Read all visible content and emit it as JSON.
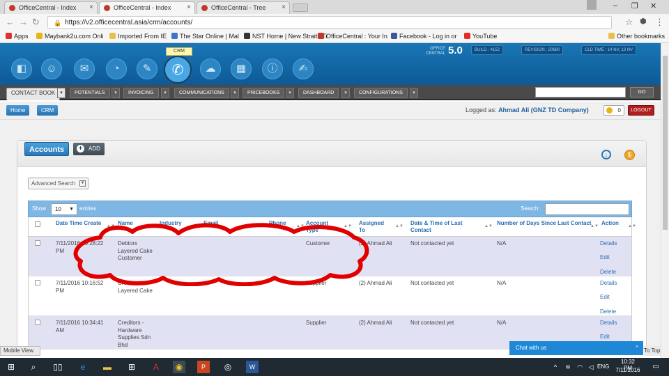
{
  "browser": {
    "tabs": [
      {
        "label": "OfficeCentral - Index"
      },
      {
        "label": "OfficeCentral - Index"
      },
      {
        "label": "OfficeCentral - Tree"
      }
    ],
    "url": "https://v2.officecentral.asia/crm/accounts/",
    "bookmarks": [
      {
        "label": "Apps",
        "color": "#d33"
      },
      {
        "label": "Maybank2u.com Onli",
        "color": "#e7b41a"
      },
      {
        "label": "Imported From IE",
        "color": "#e7c14a"
      },
      {
        "label": "The Star Online | Mal",
        "color": "#3a76c9"
      },
      {
        "label": "NST Home | New Straits Ti",
        "color": "#333"
      },
      {
        "label": "OfficeCentral : Your In",
        "color": "#c0392b"
      },
      {
        "label": "Facebook - Log in or",
        "color": "#3b5998"
      },
      {
        "label": "YouTube",
        "color": "#e52d27"
      },
      {
        "label": "Other bookmarks",
        "color": "#e7c14a"
      }
    ]
  },
  "app": {
    "crm_tooltip": "CRM",
    "brand_small": "OFFICE CENTRAL",
    "brand_version": "5.0",
    "info_boxes": [
      "BUILD : 4152",
      "REVISION : 20680",
      "CLD TIME : 14 NV, 13 NV"
    ],
    "menu": [
      {
        "label": "CONTACT BOOK"
      },
      {
        "label": "POTENTIALS"
      },
      {
        "label": "INVOICING"
      },
      {
        "label": "COMMUNICATIONS"
      },
      {
        "label": "PRICEBOOKS"
      },
      {
        "label": "DASHBOARD"
      },
      {
        "label": "CONFIGURATIONS"
      }
    ],
    "go_label": "GO",
    "breadcrumb": {
      "home": "Home",
      "current": "CRM"
    },
    "logged_label": "Logged as:",
    "logged_user": "Ahmad Ali (GNZ TD Company)",
    "notif_count": "0",
    "logout_label": "LOGOUT"
  },
  "panel": {
    "title": "Accounts",
    "add_label": "ADD",
    "advanced_search": "Advanced Search",
    "show_label": "Show",
    "show_value": "10",
    "entries_label": "entries",
    "search_label": "Search:",
    "columns": [
      {
        "label": "Date Time Create"
      },
      {
        "label": "Name"
      },
      {
        "label": "Industry"
      },
      {
        "label": "Email"
      },
      {
        "label": "Phone"
      },
      {
        "label": "Account Type"
      },
      {
        "label": "Assigned To"
      },
      {
        "label": "Date & Time of Last Contact"
      },
      {
        "label": "Number of Days Since Last Contact"
      },
      {
        "label": "Action"
      }
    ],
    "rows": [
      {
        "date": "7/11/2016 10:28:22 PM",
        "name": "Debtors Layered Cake Customer",
        "type": "Customer",
        "assigned": "(2) Ahmad Ali",
        "last": "Not contacted yet",
        "days": "N/A",
        "a1": "Details",
        "a2": "Edit",
        "a3": "Delete"
      },
      {
        "date": "7/11/2016 10:16:52 PM",
        "name": "Creditor Layered Cake",
        "type": "Supplier",
        "assigned": "(2) Ahmad Ali",
        "last": "Not contacted yet",
        "days": "N/A",
        "a1": "Details",
        "a2": "Edit",
        "a3": "Delete"
      },
      {
        "date": "7/11/2016 10:34:41 AM",
        "name": "Creditors - Hardware Supplies Sdn Bhd",
        "type": "Supplier",
        "assigned": "(2) Ahmad Ali",
        "last": "Not contacted yet",
        "days": "N/A",
        "a1": "Details",
        "a2": "Edit",
        "a3": ""
      }
    ]
  },
  "footer": {
    "mobile_view": "Mobile View",
    "chat": "Chat with us",
    "to_top": "To Top"
  },
  "taskbar": {
    "time": "10:32 PM",
    "date": "7/11/2016",
    "lang": "ENG"
  },
  "colors": {
    "header_blue": "#0d5a96",
    "accent": "#2b6fb0",
    "annotation_red": "#e00000"
  }
}
